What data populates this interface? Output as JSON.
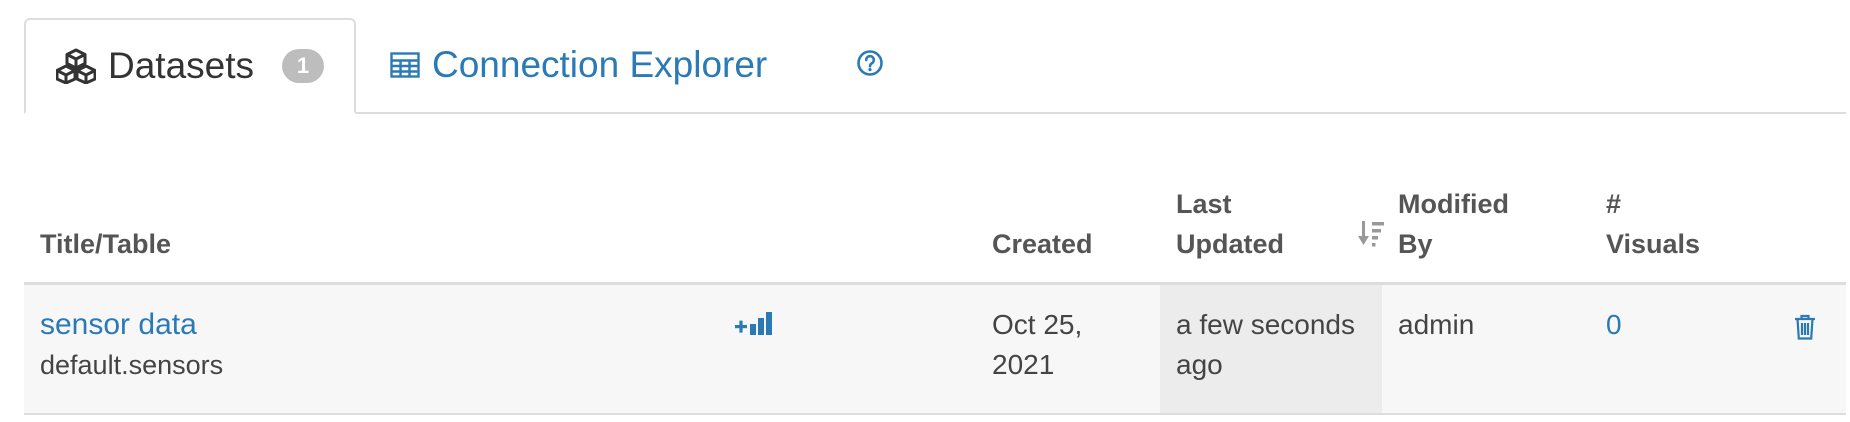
{
  "tabs": {
    "datasets": {
      "label": "Datasets",
      "count": "1",
      "icon": "cubes-icon"
    },
    "connection_explorer": {
      "label": "Connection Explorer",
      "icon": "table-grid-icon"
    },
    "help": {
      "icon": "question-circle-icon"
    }
  },
  "table": {
    "headers": {
      "title": "Title/Table",
      "created": "Created",
      "updated_line1": "Last",
      "updated_line2": "Updated",
      "modified_line1": "Modified",
      "modified_line2": "By",
      "visuals_line1": "#",
      "visuals_line2": "Visuals"
    },
    "sort": {
      "column": "Last Updated",
      "direction": "descending",
      "icon": "sort-desc-icon"
    },
    "rows": [
      {
        "title": "sensor data",
        "table": "default.sensors",
        "new_visual_icon": "new-visual-icon",
        "created_line1": "Oct 25,",
        "created_line2": "2021",
        "updated_line1": "a few seconds",
        "updated_line2": "ago",
        "modified_by": "admin",
        "visuals": "0",
        "delete_icon": "trash-icon"
      }
    ]
  },
  "colors": {
    "link": "#2a7ab5",
    "border": "#dddddd",
    "badge": "#bdbdbd",
    "row_bg": "#f7f7f7",
    "sorted_col_bg": "#ececec"
  }
}
